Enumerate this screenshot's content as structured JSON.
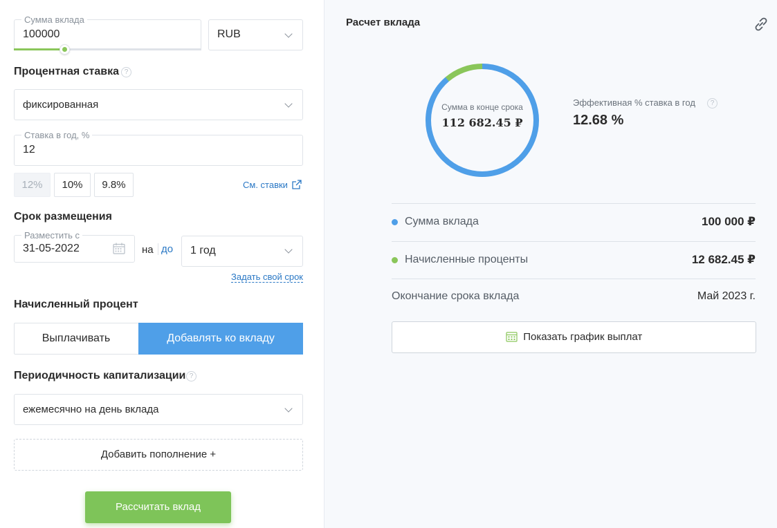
{
  "deposit": {
    "amount_label": "Сумма вклада",
    "amount_value": "100000",
    "slider_fill": 0.27,
    "currency": "RUB"
  },
  "rate": {
    "title": "Процентная ставка",
    "help": "?",
    "type": "фиксированная",
    "per_year_label": "Ставка в год, %",
    "per_year_value": "12",
    "chips": [
      "12%",
      "10%",
      "9.8%"
    ],
    "see_rates_link": "См. ставки"
  },
  "term": {
    "title": "Срок размещения",
    "place_from_label": "Разместить с",
    "date_value": "31-05-2022",
    "on_text": "на",
    "to_link": "до",
    "period": "1 год",
    "custom_link": "Задать свой срок"
  },
  "interest": {
    "title": "Начисленный процент",
    "options": [
      "Выплачивать",
      "Добавлять ко вкладу"
    ],
    "selected_index": 1
  },
  "capitalization": {
    "title": "Периодичность капитализации",
    "help": "?",
    "value": "ежемесячно на день вклада"
  },
  "add_topup_button": "Добавить пополнение +",
  "calculate_button": "Рассчитать вклад",
  "result": {
    "title": "Расчет вклада",
    "donut_label": "Сумма в конце срока",
    "donut_value": "112 682.45 ₽",
    "effective_rate_label": "Эффективная % ставка в год",
    "effective_rate_help": "?",
    "effective_rate_value": "12.68 %",
    "rows": [
      {
        "label": "Сумма вклада",
        "value": "100 000 ₽"
      },
      {
        "label": "Начисленные проценты",
        "value": "12 682.45 ₽"
      },
      {
        "label": "Окончание срока вклада",
        "value": "Май 2023 г."
      }
    ],
    "schedule_button": "Показать график выплат"
  },
  "colors": {
    "primary_blue": "#4f9fe8",
    "green": "#8ac65a",
    "button_green": "#7ec459",
    "link_blue": "#2a78c5"
  },
  "chart_data": {
    "type": "pie",
    "title": "",
    "series": [
      {
        "name": "Сумма вклада",
        "value": 100000
      },
      {
        "name": "Начисленные проценты",
        "value": 12682.45
      }
    ]
  }
}
